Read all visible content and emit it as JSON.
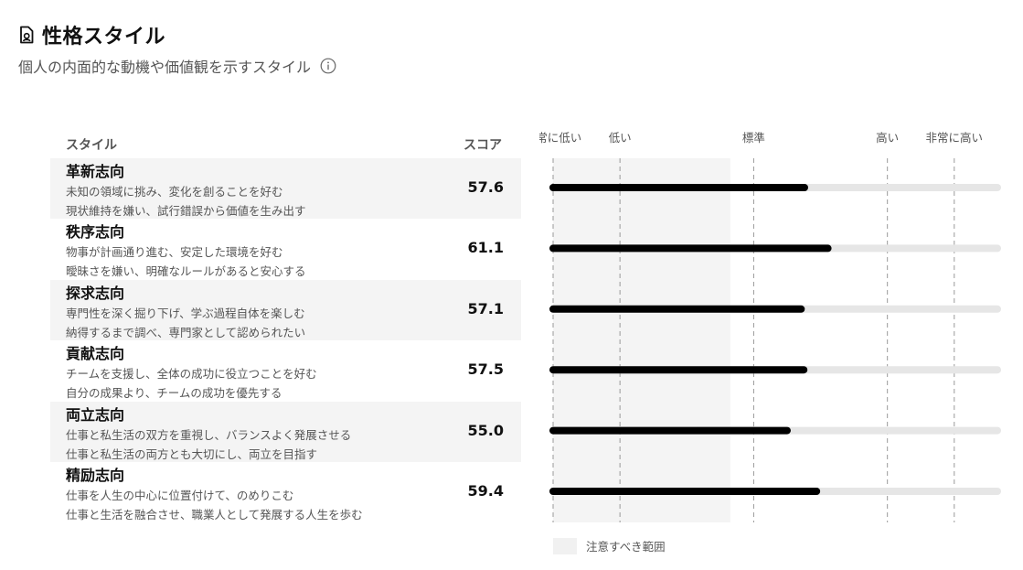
{
  "header": {
    "title": "性格スタイル",
    "subtitle": "個人の内面的な動機や価値観を示すスタイル"
  },
  "columns": {
    "style": "スタイル",
    "score": "スコア"
  },
  "chart_data": {
    "type": "bar",
    "orientation": "horizontal",
    "axis_labels": [
      {
        "label": "非常に低い",
        "value": 20
      },
      {
        "label": "低い",
        "value": 30
      },
      {
        "label": "標準",
        "value": 50
      },
      {
        "label": "高い",
        "value": 70
      },
      {
        "label": "非常に高い",
        "value": 80
      }
    ],
    "xlim": [
      20,
      87
    ],
    "caution_range": [
      20,
      46.5
    ],
    "legend": "注意すべき範囲",
    "rows": [
      {
        "name": "革新志向",
        "desc1": "未知の領域に挑み、変化を創ることを好む",
        "desc2": "現状維持を嫌い、試行錯誤から価値を生み出す",
        "score": "57.6",
        "value": 57.6
      },
      {
        "name": "秩序志向",
        "desc1": "物事が計画通り進む、安定した環境を好む",
        "desc2": "曖昧さを嫌い、明確なルールがあると安心する",
        "score": "61.1",
        "value": 61.1
      },
      {
        "name": "探求志向",
        "desc1": "専門性を深く掘り下げ、学ぶ過程自体を楽しむ",
        "desc2": "納得するまで調べ、専門家として認められたい",
        "score": "57.1",
        "value": 57.1
      },
      {
        "name": "貢献志向",
        "desc1": "チームを支援し、全体の成功に役立つことを好む",
        "desc2": "自分の成果より、チームの成功を優先する",
        "score": "57.5",
        "value": 57.5
      },
      {
        "name": "両立志向",
        "desc1": "仕事と私生活の双方を重視し、バランスよく発展させる",
        "desc2": "仕事と私生活の両方とも大切にし、両立を目指す",
        "score": "55.0",
        "value": 55.0
      },
      {
        "name": "精励志向",
        "desc1": "仕事を人生の中心に位置付けて、のめりこむ",
        "desc2": "仕事と生活を融合させ、職業人として発展する人生を歩む",
        "score": "59.4",
        "value": 59.4
      }
    ],
    "colors": {
      "bar": "#000000",
      "track": "#e6e6e6",
      "caution": "#f4f4f4",
      "gridline": "#999999"
    }
  }
}
